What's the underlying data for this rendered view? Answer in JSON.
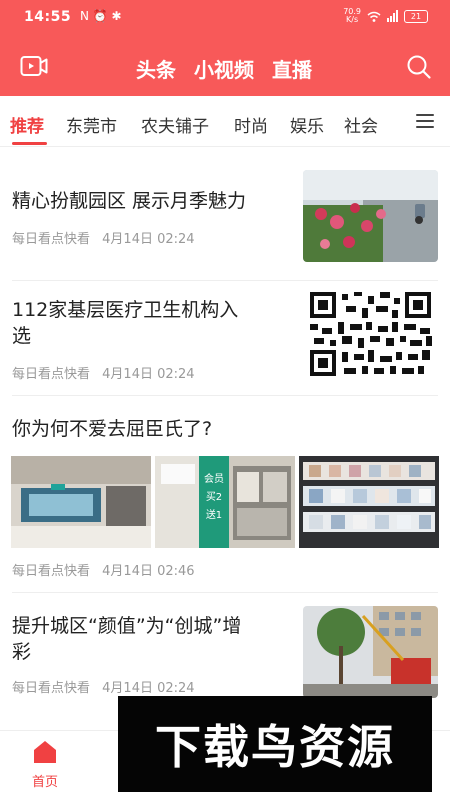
{
  "status_bar": {
    "time": "14:55",
    "left_icons": "N ⏰ ✱",
    "net_speed_value": "70.9",
    "net_speed_unit": "K/s",
    "battery": "21"
  },
  "header": {
    "tabs": [
      "头条",
      "小视频",
      "直播"
    ]
  },
  "channels": [
    "推荐",
    "东莞市",
    "农夫铺子",
    "时尚",
    "娱乐",
    "社会"
  ],
  "articles": [
    {
      "title": "精心扮靓园区 展示月季魅力",
      "source": "每日看点快看",
      "date": "4月14日 02:24"
    },
    {
      "title_line1": "112家基层医疗卫生机构入",
      "title_line2": "选",
      "source": "每日看点快看",
      "date": "4月14日 02:24"
    },
    {
      "title": "你为何不爱去屈臣氏了?",
      "source": "每日看点快看",
      "date": "4月14日 02:46",
      "image_sign": "会员买2送1"
    },
    {
      "title_line1": "提升城区“颜值”为“创城”增",
      "title_line2": "彩",
      "source": "每日看点快看",
      "date": "4月14日 02:24"
    }
  ],
  "tabbar": {
    "home_label": "首页"
  },
  "watermark": "下载鸟资源",
  "colors": {
    "brand_red": "#f85959",
    "accent_red": "#f04142"
  }
}
